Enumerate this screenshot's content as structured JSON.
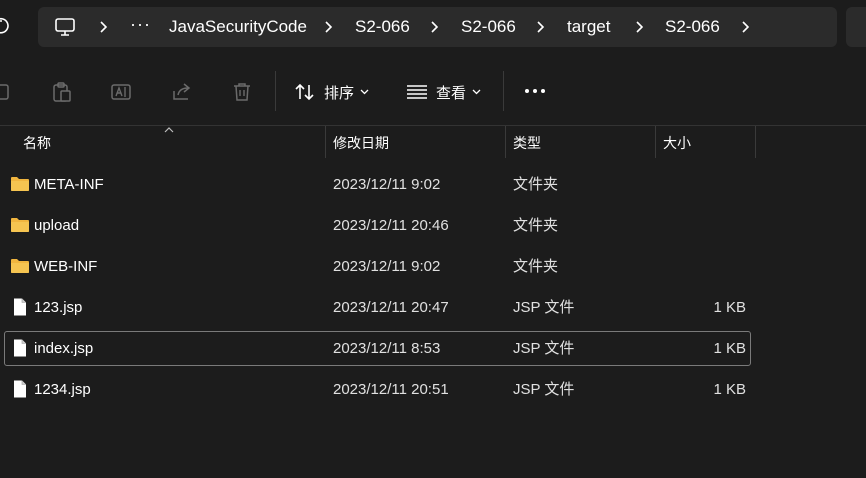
{
  "address_bar": {
    "overflow_label": "···",
    "crumbs": [
      "JavaSecurityCode",
      "S2-066",
      "S2-066",
      "target",
      "S2-066"
    ]
  },
  "toolbar": {
    "sort_label": "排序",
    "view_label": "查看"
  },
  "columns": {
    "name": "名称",
    "modified": "修改日期",
    "type": "类型",
    "size": "大小"
  },
  "files": [
    {
      "name": "META-INF",
      "modified": "2023/12/11 9:02",
      "type": "文件夹",
      "size": "",
      "icon": "folder-icon"
    },
    {
      "name": "upload",
      "modified": "2023/12/11 20:46",
      "type": "文件夹",
      "size": "",
      "icon": "folder-icon"
    },
    {
      "name": "WEB-INF",
      "modified": "2023/12/11 9:02",
      "type": "文件夹",
      "size": "",
      "icon": "folder-icon"
    },
    {
      "name": "123.jsp",
      "modified": "2023/12/11 20:47",
      "type": "JSP 文件",
      "size": "1 KB",
      "icon": "file-icon"
    },
    {
      "name": "index.jsp",
      "modified": "2023/12/11 8:53",
      "type": "JSP 文件",
      "size": "1 KB",
      "icon": "file-icon"
    },
    {
      "name": "1234.jsp",
      "modified": "2023/12/11 20:51",
      "type": "JSP 文件",
      "size": "1 KB",
      "icon": "file-icon"
    }
  ],
  "colors": {
    "background": "#1c1c1c",
    "address_bg": "#2b2b2b",
    "folder": "#f5c451",
    "focus_border": "#7a7a7a"
  }
}
